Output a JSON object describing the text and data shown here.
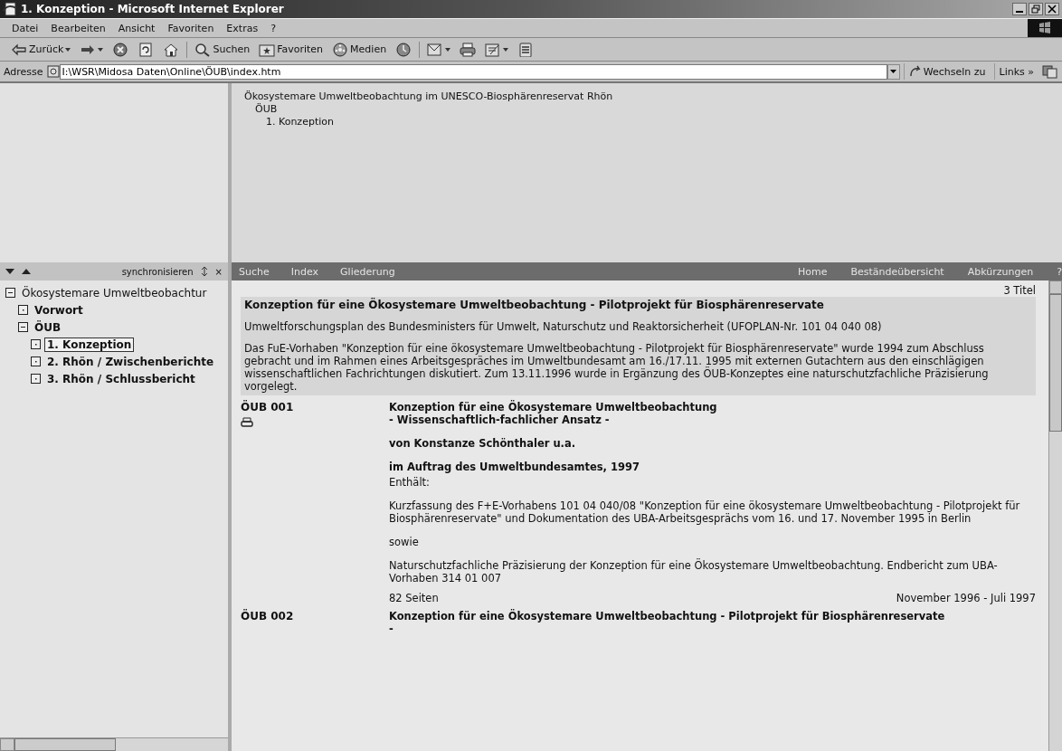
{
  "window": {
    "title": "1. Konzeption - Microsoft Internet Explorer"
  },
  "menu": [
    "Datei",
    "Bearbeiten",
    "Ansicht",
    "Favoriten",
    "Extras",
    "?"
  ],
  "toolbar": [
    [
      {
        "kind": "back",
        "label": "Zurück",
        "dropdown": true
      },
      {
        "kind": "forward",
        "dropdown": true
      },
      {
        "kind": "stop"
      },
      {
        "kind": "refresh"
      },
      {
        "kind": "home"
      }
    ],
    [
      {
        "kind": "search",
        "label": "Suchen"
      },
      {
        "kind": "favorites",
        "label": "Favoriten"
      },
      {
        "kind": "media",
        "label": "Medien"
      },
      {
        "kind": "history"
      }
    ],
    [
      {
        "kind": "mail",
        "dropdown": true
      },
      {
        "kind": "print"
      },
      {
        "kind": "edit",
        "dropdown": true
      },
      {
        "kind": "discuss"
      }
    ]
  ],
  "address": {
    "label": "Adresse",
    "value": "I:\\WSR\\Midosa Daten\\Online\\ÖUB\\index.htm",
    "go": "Wechseln zu",
    "links": "Links",
    "more": "»"
  },
  "breadcrumb": {
    "lines": [
      "Ökosystemare Umweltbeobachtung im UNESCO-Biosphärenreservat Rhön",
      "ÖUB",
      "1. Konzeption"
    ]
  },
  "sidebar": {
    "sync": "synchronisieren",
    "close": "×",
    "tree": [
      {
        "label": "Ökosystemare Umweltbeobachtur",
        "expanded": true,
        "selected": false,
        "children": [
          {
            "label": "Vorwort",
            "expanded": false,
            "selected": false
          },
          {
            "label": "ÖUB",
            "expanded": true,
            "selected": false,
            "children": [
              {
                "label": "1. Konzeption",
                "expanded": false,
                "selected": true
              },
              {
                "label": "2. Rhön / Zwischenberichte",
                "expanded": false,
                "selected": false
              },
              {
                "label": "3. Rhön / Schlussbericht",
                "expanded": false,
                "selected": false
              }
            ]
          }
        ]
      }
    ]
  },
  "navbar": {
    "left": [
      "Suche",
      "Index",
      "Gliederung"
    ],
    "right": [
      "Home",
      "Beständeübersicht",
      "Abkürzungen",
      "?"
    ]
  },
  "content": {
    "count": "3 Titel",
    "intro": {
      "title": "Konzeption für eine Ökosystemare Umweltbeobachtung - Pilotprojekt für Biosphärenreservate",
      "subtitle": "Umweltforschungsplan des Bundesministers für Umwelt, Naturschutz und Reaktorsicherheit (UFOPLAN-Nr. 101 04 040 08)",
      "text": "Das FuE-Vorhaben \"Konzeption für eine ökosystemare Umweltbeobachtung - Pilotprojekt für Biosphärenreservate\" wurde 1994 zum Abschluss gebracht und im Rahmen eines Arbeitsgespräches im Umweltbundesamt am 16./17.11. 1995 mit externen Gutachtern aus den einschlägigen wissenschaftlichen Fachrichtungen diskutiert. Zum 13.11.1996 wurde in Ergänzung des ÖUB-Konzeptes eine naturschutzfachliche Präzisierung vorgelegt."
    },
    "entries": [
      {
        "id": "ÖUB 001",
        "printable": true,
        "title": [
          "Konzeption für eine Ökosystemare Umweltbeobachtung",
          "- Wissenschaftlich-fachlicher Ansatz -"
        ],
        "author": "von Konstanze Schönthaler u.a.",
        "commission": "im Auftrag des Umweltbundesamtes, 1997",
        "contains": "Enthält:",
        "paragraphs": [
          "Kurzfassung des F+E-Vorhabens 101 04 040/08 \"Konzeption für eine ökosystemare Umweltbeobachtung - Pilotprojekt für Biosphärenreservate\" und Dokumentation des UBA-Arbeitsgesprächs vom 16. und 17. November 1995 in Berlin",
          "sowie",
          "Naturschutzfachliche Präzisierung der Konzeption für eine Ökosystemare Umweltbeobachtung. Endbericht zum UBA-Vorhaben 314 01 007"
        ],
        "pages": "82 Seiten",
        "date": "November 1996 - Juli 1997"
      },
      {
        "id": "ÖUB 002",
        "title": [
          "Konzeption für eine Ökosystemare Umweltbeobachtung - Pilotprojekt für Biosphärenreservate",
          "-"
        ]
      }
    ]
  }
}
